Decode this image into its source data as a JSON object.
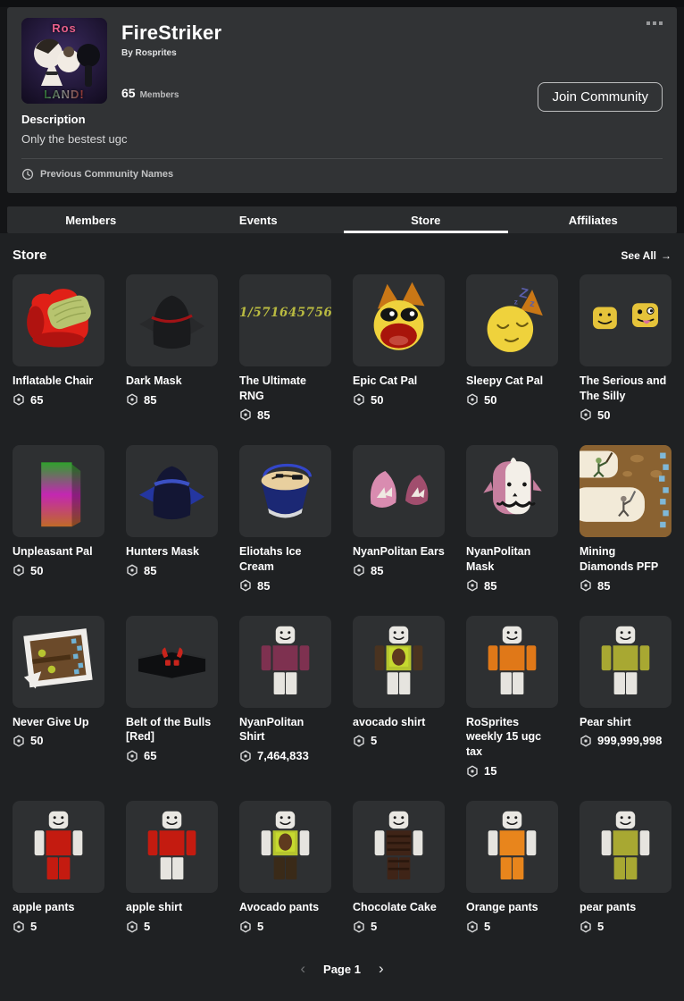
{
  "colors": {
    "page_bg": "#141517",
    "section_bg": "#1f2123",
    "card_bg": "#313335",
    "tabbar_bg": "#2b2d2f",
    "tile_bg": "#2e3032",
    "text_primary": "#ffffff",
    "text_secondary": "#bcbdbe",
    "divider": "#47494b",
    "underline": "#ffffff"
  },
  "icons": {
    "menu": "ellipsis-menu-icon",
    "clock": "clock-icon",
    "robux": "robux-icon",
    "arrow_right": "→",
    "chevron_left": "‹",
    "chevron_right": "›"
  },
  "header": {
    "title": "FireStriker",
    "by_label": "By Rosprites",
    "member_count": "65",
    "members_label": "Members",
    "join_button": "Join Community",
    "avatar_text_top": "Ros",
    "avatar_text_bottom": "LAND!",
    "description_label": "Description",
    "description_text": "Only the bestest ugc",
    "previous_names_label": "Previous Community Names"
  },
  "tabs": [
    {
      "label": "Members",
      "active": false
    },
    {
      "label": "Events",
      "active": false
    },
    {
      "label": "Store",
      "active": true
    },
    {
      "label": "Affiliates",
      "active": false
    }
  ],
  "store": {
    "heading": "Store",
    "see_all_label": "See All",
    "items": [
      {
        "name": "Inflatable Chair",
        "price": "65",
        "art": {
          "type": "chair",
          "main": "#e02017",
          "shade": "#b01310",
          "blanket": "#b7c46f",
          "blanket_line": "#96a553"
        }
      },
      {
        "name": "Dark Mask",
        "price": "85",
        "art": {
          "type": "helmet",
          "main": "#1a1b1d",
          "fins": "#28292b",
          "slit": "#a01316"
        }
      },
      {
        "name": "The Ultimate RNG",
        "price": "85",
        "art": {
          "type": "text",
          "text": "1/571645756",
          "color": "#b9ba41"
        }
      },
      {
        "name": "Epic Cat Pal",
        "price": "50",
        "art": {
          "type": "cat-open",
          "head": "#efd23c",
          "ears": "#c97716",
          "mouth": "#a8150b",
          "tongue": "#c4473a"
        }
      },
      {
        "name": "Sleepy Cat Pal",
        "price": "50",
        "art": {
          "type": "cat-sleep",
          "head": "#efd23c",
          "ears": "#c97716",
          "z": "#5a5da8",
          "line": "#6b5a10"
        }
      },
      {
        "name": "The Serious and The Silly",
        "price": "50",
        "art": {
          "type": "two-heads",
          "head": "#e5c33a",
          "tongue": "#d86f9c"
        }
      },
      {
        "name": "Unpleasant Pal",
        "price": "50",
        "art": {
          "type": "slab",
          "top": "#2fa12c",
          "mid": "#c327b2",
          "bottom": "#c06a28"
        }
      },
      {
        "name": "Hunters Mask",
        "price": "85",
        "art": {
          "type": "helmet",
          "main": "#131634",
          "fins": "#2436a0",
          "band": "#3b50c4"
        }
      },
      {
        "name": "Eliotahs Ice Cream",
        "price": "85",
        "art": {
          "type": "bucket",
          "body": "#1b2874",
          "top": "#e8cf9e",
          "handle": "#3346c9",
          "rim": "#d8d9db",
          "mark": "#3a2d18"
        }
      },
      {
        "name": "NyanPolitan Ears",
        "price": "85",
        "art": {
          "type": "ears",
          "outer": "#d98cb0",
          "outer2": "#a14e6e",
          "inner": "#efe9e2"
        }
      },
      {
        "name": "NyanPolitan Mask",
        "price": "85",
        "art": {
          "type": "np-face",
          "side": "#c77f9f",
          "face": "#f3efe8",
          "ink": "#161616"
        }
      },
      {
        "name": "Mining Diamonds PFP",
        "price": "85",
        "art": {
          "type": "comic",
          "dirt": "#8a6231",
          "spot": "#a57a42",
          "paper": "#f2ead8",
          "gem": "#7fb8d8"
        }
      },
      {
        "name": "Never Give Up",
        "price": "50",
        "art": {
          "type": "frame",
          "frame": "#efedea",
          "inner": "#6b4a2a",
          "shelf": "#4a3015",
          "gem": "#6fb1d4",
          "bird": "#b7c430"
        }
      },
      {
        "name": "Belt of the Bulls [Red]",
        "price": "65",
        "art": {
          "type": "belt",
          "band": "#0e0f11",
          "edge": "#2c2e30",
          "emblem": "#c8241c"
        }
      },
      {
        "name": "NyanPolitan Shirt",
        "price": "7,464,833",
        "art": {
          "type": "avatar",
          "torso": "#7e3150",
          "arms": "#7e3150",
          "legs": "#e6e4df"
        }
      },
      {
        "name": "avocado shirt",
        "price": "5",
        "art": {
          "type": "avatar",
          "torso": "#b5c42e",
          "plate": "#c6d92f",
          "pit": "#5f3a1e",
          "arms": "#4a3320",
          "legs": "#e6e4df"
        }
      },
      {
        "name": "RoSprites weekly 15 ugc tax",
        "price": "15",
        "art": {
          "type": "avatar",
          "torso": "#e07818",
          "arms": "#e07818",
          "legs": "#e6e4df"
        }
      },
      {
        "name": "Pear shirt",
        "price": "999,999,998",
        "art": {
          "type": "avatar",
          "torso": "#a8a832",
          "arms": "#a8a832",
          "legs": "#e6e4df"
        }
      },
      {
        "name": "apple pants",
        "price": "5",
        "art": {
          "type": "avatar",
          "torso": "#c41b10",
          "arms": "#e6e4df",
          "legs": "#c41b10"
        }
      },
      {
        "name": "apple shirt",
        "price": "5",
        "art": {
          "type": "avatar",
          "torso": "#c41b10",
          "arms": "#c41b10",
          "legs": "#e6e4df"
        }
      },
      {
        "name": "Avocado pants",
        "price": "5",
        "art": {
          "type": "avatar",
          "torso": "#b5c42e",
          "plate": "#c6d92f",
          "pit": "#5f3a1e",
          "arms": "#e6e4df",
          "legs": "#3a2a18"
        }
      },
      {
        "name": "Chocolate Cake",
        "price": "5",
        "art": {
          "type": "avatar",
          "torso": "#3f2417",
          "arms": "#e6e4df",
          "legs": "#3f2417",
          "stripes": "#2a170d"
        }
      },
      {
        "name": "Orange pants",
        "price": "5",
        "art": {
          "type": "avatar",
          "torso": "#e8851c",
          "arms": "#e6e4df",
          "legs": "#e8851c"
        }
      },
      {
        "name": "pear pants",
        "price": "5",
        "art": {
          "type": "avatar",
          "torso": "#a8a832",
          "arms": "#e6e4df",
          "legs": "#a8a832"
        }
      }
    ],
    "pagination": {
      "label": "Page 1"
    }
  }
}
